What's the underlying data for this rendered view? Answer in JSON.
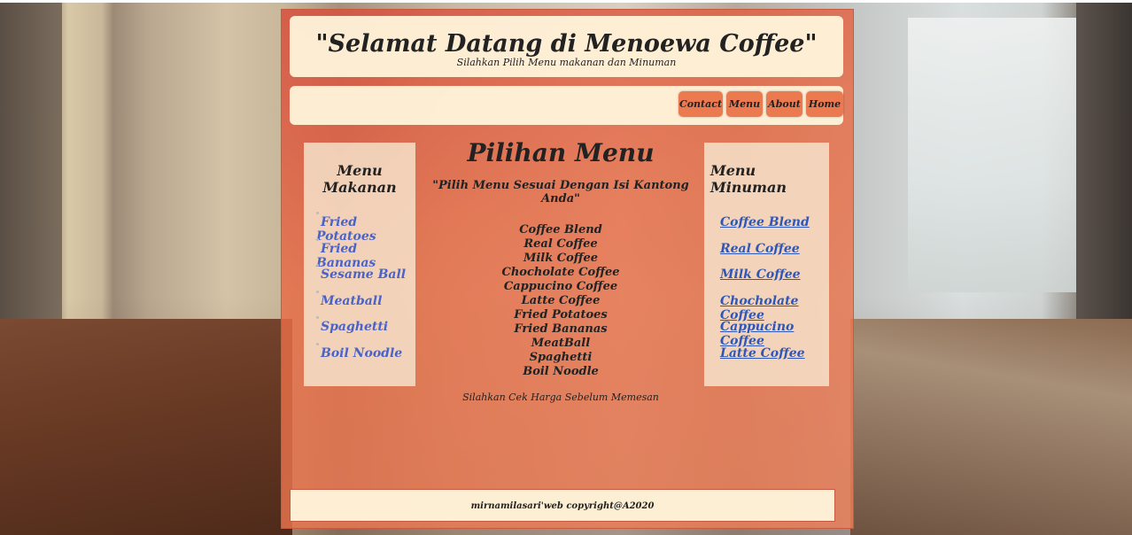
{
  "header": {
    "title": "\"Selamat Datang di Menoewa Coffee\"",
    "subtitle": "Silahkan Pilih Menu makanan dan Minuman"
  },
  "nav": [
    "Contact",
    "Menu",
    "About",
    "Home"
  ],
  "left": {
    "title": "Menu Makanan",
    "items": [
      "Fried Potatoes",
      "Fried Bananas",
      "Sesame Ball",
      "Meatball",
      "Spaghetti",
      "Boil Noodle"
    ]
  },
  "center": {
    "title": "Pilihan Menu",
    "tagline": "\"Pilih Menu Sesuai Dengan Isi Kantong Anda\"",
    "items": [
      "Coffee Blend",
      "Real Coffee",
      "Milk Coffee",
      "Chocholate Coffee",
      "Cappucino Coffee",
      "Latte Coffee",
      "Fried Potatoes",
      "Fried Bananas",
      "MeatBall",
      "Spaghetti",
      "Boil Noodle"
    ],
    "note": "Silahkan Cek Harga Sebelum Memesan"
  },
  "right": {
    "title": "Menu Minuman",
    "items": [
      "Coffee Blend",
      "Real Coffee",
      "Milk Coffee",
      "Chocholate Coffee",
      "Cappucino Coffee",
      "Latte Coffee"
    ]
  },
  "footer": {
    "text": "mirnamilasari'web copyright@A2020"
  },
  "colors": {
    "accent": "#ec7a50",
    "panel": "#fff7de",
    "link": "#2e57b8"
  }
}
